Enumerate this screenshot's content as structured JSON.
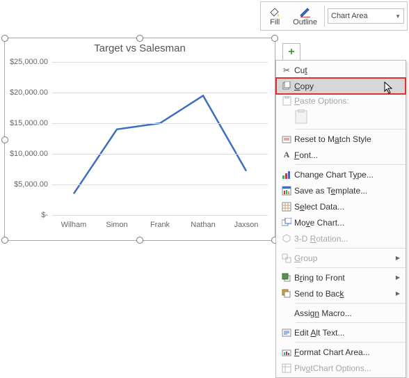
{
  "toolbar": {
    "fill_label": "Fill",
    "outline_label": "Outline",
    "selector_value": "Chart Area"
  },
  "chart_data": {
    "type": "line",
    "title": "Target vs Salesman",
    "categories": [
      "Wilham",
      "Simon",
      "Frank",
      "Nathan",
      "Jaxson"
    ],
    "values": [
      3500,
      14000,
      15000,
      19500,
      7200
    ],
    "y_ticks_labels": [
      "$-",
      "$5,000.00",
      "$10,000.00",
      "$15,000.00",
      "$20,000.00",
      "$25,000.00"
    ],
    "y_ticks_values": [
      0,
      5000,
      10000,
      15000,
      20000,
      25000
    ],
    "ylim": [
      0,
      25000
    ],
    "xlabel": "",
    "ylabel": ""
  },
  "ctx": {
    "cut": "Cut",
    "copy": "Copy",
    "paste_options": "Paste Options:",
    "reset": "Reset to Match Style",
    "font": "Font...",
    "change_type": "Change Chart Type...",
    "save_template": "Save as Template...",
    "select_data": "Select Data...",
    "move_chart": "Move Chart...",
    "rotation": "3-D Rotation...",
    "group": "Group",
    "bring_front": "Bring to Front",
    "send_back": "Send to Back",
    "assign_macro": "Assign Macro...",
    "edit_alt": "Edit Alt Text...",
    "format_area": "Format Chart Area...",
    "pivot_options": "PivotChart Options..."
  }
}
